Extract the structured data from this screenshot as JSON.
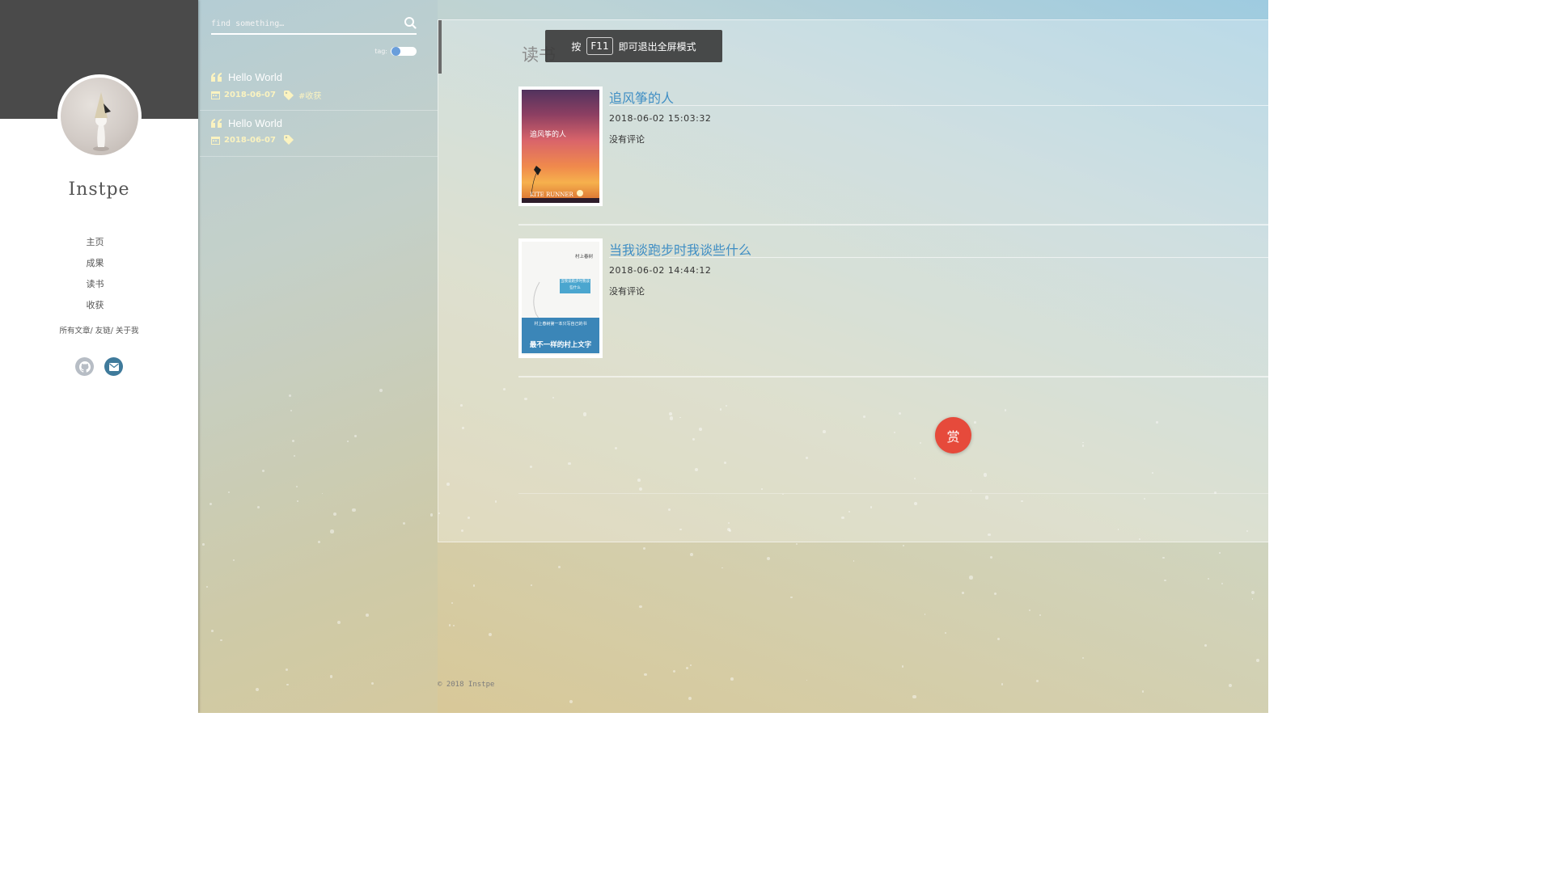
{
  "sidebar": {
    "blogger_name": "Instpe",
    "nav": [
      "主页",
      "成果",
      "读书",
      "收获"
    ],
    "links": [
      {
        "label": "所有文章"
      },
      {
        "label": "友链"
      },
      {
        "label": "关于我"
      }
    ],
    "link_separator": "/",
    "socials": [
      {
        "icon": "github-icon",
        "color": "#b7bdc5"
      },
      {
        "icon": "mail-icon",
        "color": "#3f7a9b"
      }
    ]
  },
  "search": {
    "placeholder": "find something…",
    "tag_label": "tag:"
  },
  "posts": [
    {
      "title": "Hello World",
      "date": "2018-06-07",
      "tag": "#收获"
    },
    {
      "title": "Hello World",
      "date": "2018-06-07",
      "tag": ""
    }
  ],
  "main": {
    "page_title": "读书",
    "books": [
      {
        "title": "追风筝的人",
        "date": "2018-06-02 15:03:32",
        "comments": "没有评论",
        "cover": {
          "title": "追风筝的人",
          "subtitle": "KITE RUNNER"
        }
      },
      {
        "title": "当我谈跑步时我谈些什么",
        "date": "2018-06-02 14:44:12",
        "comments": "没有评论",
        "cover": {
          "author": "村上春树",
          "title": "当我谈跑步时我谈些什么",
          "blurb": "村上春树第一本只写自己的书",
          "tagline": "最不一样的村上文字"
        }
      }
    ],
    "reward_label": "赏"
  },
  "footer": "© 2018 Instpe",
  "toast": {
    "prefix": "按",
    "key": "F11",
    "suffix": "即可退出全屏模式"
  },
  "colors": {
    "accent": "#3f8ec4",
    "reward": "#e64a3b",
    "sidebar_head": "#4a4a4a",
    "meta": "#fbf3c0"
  }
}
